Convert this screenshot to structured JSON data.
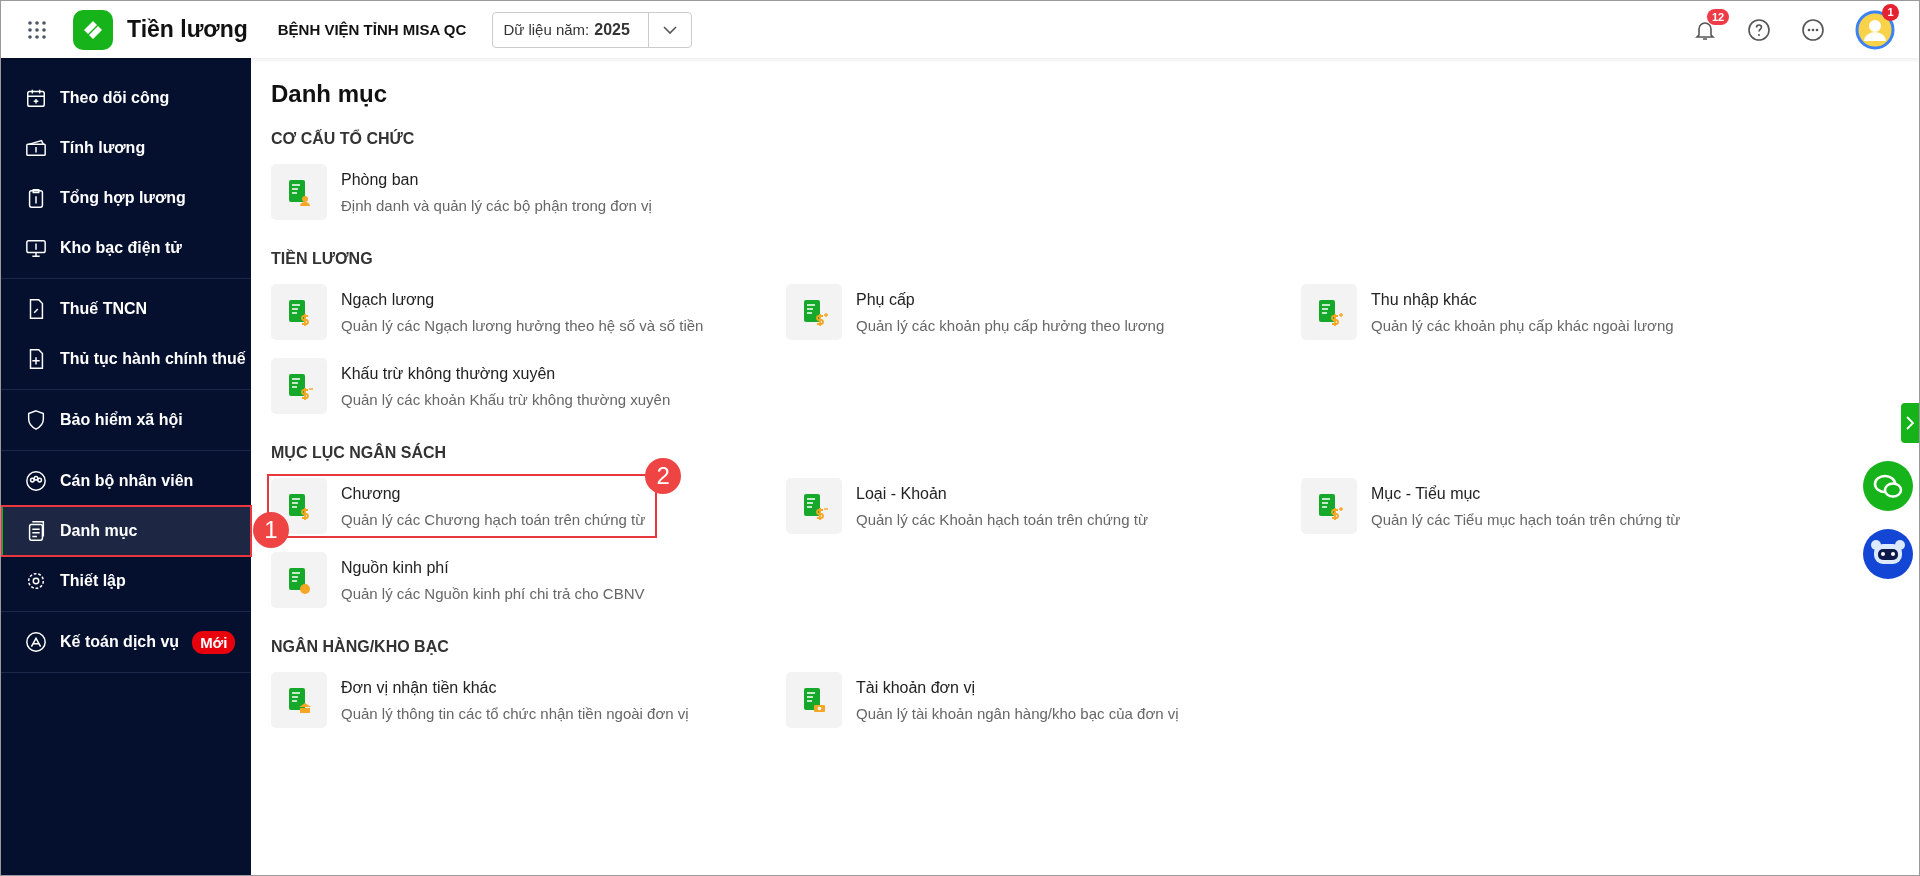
{
  "app": {
    "title": "Tiền lương",
    "organization": "BỆNH VIỆN TỈNH MISA QC",
    "year_selector": {
      "label": "Dữ liệu năm:",
      "value": "2025"
    },
    "notifications": {
      "count": "12"
    },
    "avatar": {
      "badge": "1"
    }
  },
  "sidebar": {
    "groups": [
      {
        "items": [
          {
            "label": "Theo dõi công",
            "selected": false
          },
          {
            "label": "Tính lương",
            "selected": false
          },
          {
            "label": "Tổng hợp lương",
            "selected": false
          },
          {
            "label": "Kho bạc điện tử",
            "selected": false
          }
        ]
      },
      {
        "items": [
          {
            "label": "Thuế TNCN",
            "selected": false
          },
          {
            "label": "Thủ tục hành chính thuế",
            "selected": false
          }
        ]
      },
      {
        "items": [
          {
            "label": "Bảo hiểm xã hội",
            "selected": false
          }
        ]
      },
      {
        "items": [
          {
            "label": "Cán bộ nhân viên",
            "selected": false
          },
          {
            "label": "Danh mục",
            "selected": true,
            "callout": "1"
          },
          {
            "label": "Thiết lập",
            "selected": false
          }
        ]
      },
      {
        "items": [
          {
            "label": "Kế toán dịch vụ",
            "selected": false,
            "badge": "Mới"
          }
        ]
      }
    ]
  },
  "page": {
    "title": "Danh mục",
    "sections": [
      {
        "title": "CƠ CẤU TỔ CHỨC",
        "items": [
          {
            "title": "Phòng ban",
            "description": "Định danh và quản lý các bộ phận trong đơn vị"
          }
        ]
      },
      {
        "title": "TIỀN LƯƠNG",
        "items": [
          {
            "title": "Ngạch lương",
            "description": "Quản lý các Ngạch lương hưởng theo hệ số và số tiền"
          },
          {
            "title": "Phụ cấp",
            "description": "Quản lý các khoản phụ cấp hưởng theo lương"
          },
          {
            "title": "Thu nhập khác",
            "description": "Quản lý các khoản phụ cấp khác ngoài lương"
          },
          {
            "title": "Khấu trừ không thường xuyên",
            "description": "Quản lý các khoản Khấu trừ không thường xuyên"
          }
        ]
      },
      {
        "title": "MỤC LỤC NGÂN SÁCH",
        "items": [
          {
            "title": "Chương",
            "description": "Quản lý các Chương hạch toán trên chứng từ",
            "callout": "2"
          },
          {
            "title": "Loại - Khoản",
            "description": "Quản lý các Khoản hạch toán trên chứng từ"
          },
          {
            "title": "Mục - Tiểu mục",
            "description": "Quản lý các Tiểu mục hạch toán trên chứng từ"
          },
          {
            "title": "Nguồn kinh phí",
            "description": "Quản lý các Nguồn kinh phí chi trả cho CBNV"
          }
        ]
      },
      {
        "title": "NGÂN HÀNG/KHO BẠC",
        "items": [
          {
            "title": "Đơn vị nhận tiền khác",
            "description": "Quản lý thông tin các tổ chức nhận tiền ngoài đơn vị"
          },
          {
            "title": "Tài khoản đơn vị",
            "description": "Quản lý tài khoản ngân hàng/kho bạc của đơn vị"
          }
        ]
      }
    ]
  }
}
